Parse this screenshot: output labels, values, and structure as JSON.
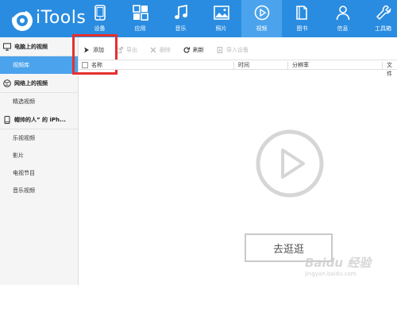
{
  "app": {
    "title": "iTools"
  },
  "nav": [
    {
      "label": "设备",
      "icon": "tablet-icon"
    },
    {
      "label": "应用",
      "icon": "apps-grid-icon"
    },
    {
      "label": "音乐",
      "icon": "music-note-icon"
    },
    {
      "label": "照片",
      "icon": "photo-icon"
    },
    {
      "label": "视频",
      "icon": "play-circle-icon",
      "active": true
    },
    {
      "label": "图书",
      "icon": "book-icon"
    },
    {
      "label": "信息",
      "icon": "person-icon"
    },
    {
      "label": "工具箱",
      "icon": "wrench-icon"
    }
  ],
  "sidebar": {
    "sections": [
      {
        "title": "电脑上的视频",
        "icon": "monitor-icon",
        "items": [
          "视频库"
        ]
      },
      {
        "title": "网络上的视频",
        "icon": "globe-icon",
        "items": [
          "精选视频"
        ]
      },
      {
        "title": "帽帅的人” 的 iPh...",
        "icon": "phone-icon",
        "items": [
          "乐视视频",
          "影片",
          "电视节目",
          "音乐视频"
        ]
      }
    ],
    "active_item": "视频库"
  },
  "toolbar": {
    "add_label": "添加",
    "export_label": "导出",
    "delete_label": "删除",
    "refresh_label": "刷新",
    "import_label": "导入设备"
  },
  "table": {
    "columns": [
      "名称",
      "时间",
      "分辨率",
      "文件"
    ]
  },
  "empty_state": {
    "button_label": "去逛逛"
  },
  "watermark": {
    "text": "Baidu 经验",
    "url": "jingyan.baidu.com"
  },
  "colors": {
    "topbar": "#2a8ce0",
    "active": "#4aa3ec",
    "highlight": "#e5302f"
  }
}
